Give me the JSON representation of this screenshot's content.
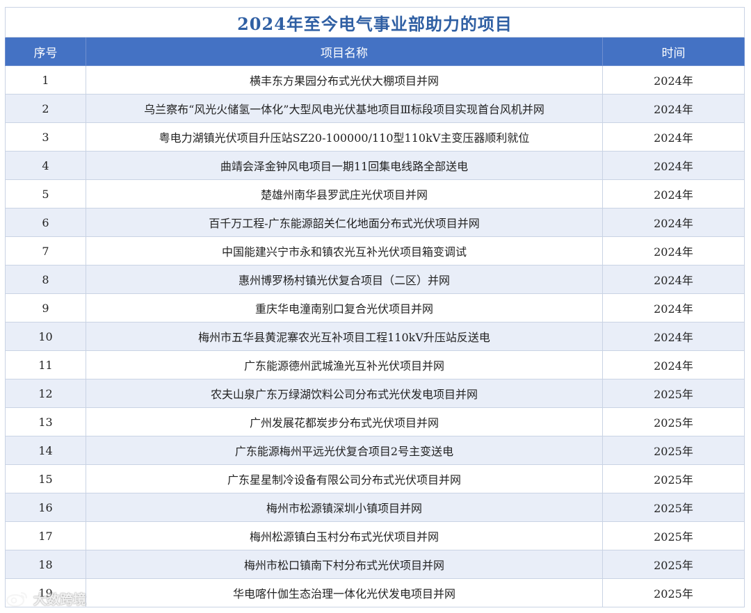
{
  "title": "2024年至今电气事业部助力的项目",
  "headers": {
    "no": "序号",
    "name": "项目名称",
    "time": "时间"
  },
  "rows": [
    {
      "no": "1",
      "name": "横丰东方果园分布式光伏大棚项目并网",
      "time": "2024年"
    },
    {
      "no": "2",
      "name": "乌兰察布“风光火储氢一体化”大型风电光伏基地项目Ⅲ标段项目实现首台风机并网",
      "time": "2024年"
    },
    {
      "no": "3",
      "name": "粤电力湖镇光伏项目升压站SZ20-100000/110型110kV主变压器顺利就位",
      "time": "2024年"
    },
    {
      "no": "4",
      "name": "曲靖会泽金钟风电项目一期11回集电线路全部送电",
      "time": "2024年"
    },
    {
      "no": "5",
      "name": "楚雄州南华县罗武庄光伏项目并网",
      "time": "2024年"
    },
    {
      "no": "6",
      "name": "百千万工程-广东能源韶关仁化地面分布式光伏项目并网",
      "time": "2024年"
    },
    {
      "no": "7",
      "name": "中国能建兴宁市永和镇农光互补光伏项目箱变调试",
      "time": "2024年"
    },
    {
      "no": "8",
      "name": "惠州博罗杨村镇光伏复合项目（二区）并网",
      "time": "2024年"
    },
    {
      "no": "9",
      "name": "重庆华电潼南别口复合光伏项目并网",
      "time": "2024年"
    },
    {
      "no": "10",
      "name": "梅州市五华县黄泥寨农光互补项目工程110kV升压站反送电",
      "time": "2024年"
    },
    {
      "no": "11",
      "name": "广东能源德州武城渔光互补光伏项目并网",
      "time": "2024年"
    },
    {
      "no": "12",
      "name": "农夫山泉广东万绿湖饮料公司分布式光伏发电项目并网",
      "time": "2025年"
    },
    {
      "no": "13",
      "name": "广州发展花都炭步分布式光伏项目并网",
      "time": "2025年"
    },
    {
      "no": "14",
      "name": "广东能源梅州平远光伏复合项目2号主变送电",
      "time": "2025年"
    },
    {
      "no": "15",
      "name": "广东星星制冷设备有限公司分布式光伏项目并网",
      "time": "2025年"
    },
    {
      "no": "16",
      "name": "梅州市松源镇深圳小镇项目并网",
      "time": "2025年"
    },
    {
      "no": "17",
      "name": "梅州松源镇白玉村分布式光伏项目并网",
      "time": "2025年"
    },
    {
      "no": "18",
      "name": "梅州市松口镇南下村分布式光伏项目并网",
      "time": "2025年"
    },
    {
      "no": "19",
      "name": "华电喀什伽生态治理一体化光伏发电项目并网",
      "time": "2025年"
    }
  ],
  "colors": {
    "title": "#2f5fa3",
    "header_bg": "#4472c4",
    "row_alt_bg": "#e9eef8"
  },
  "watermark": {
    "text": "大数跨境",
    "icon": "weibo-logo-icon"
  }
}
